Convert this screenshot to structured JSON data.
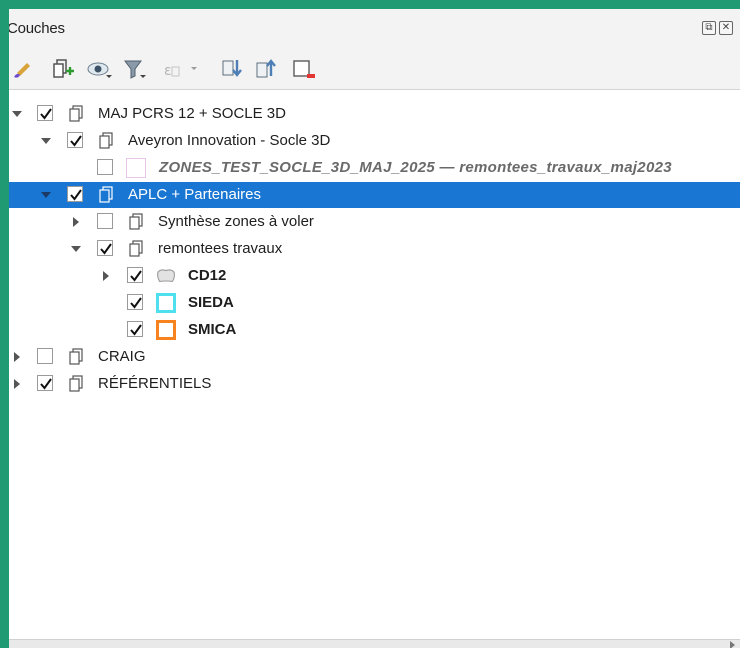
{
  "panel": {
    "title": "Couches"
  },
  "toolbar": {
    "icons": [
      "paint-brush-icon",
      "add-group-icon",
      "visibility-eye-icon",
      "filter-icon",
      "filter-expression-icon",
      "expand-all-icon",
      "collapse-all-icon",
      "remove-layer-icon"
    ]
  },
  "layers": [
    {
      "label": "MAJ PCRS 12 + SOCLE 3D",
      "checked": true,
      "expanded": true,
      "type": "group"
    },
    {
      "label": "Aveyron Innovation - Socle 3D",
      "checked": true,
      "expanded": true,
      "type": "group"
    },
    {
      "label": "ZONES_TEST_SOCLE_3D_MAJ_2025 — remontees_travaux_maj2023",
      "checked": false,
      "type": "layer",
      "style": "italic"
    },
    {
      "label": "APLC + Partenaires",
      "checked": true,
      "expanded": true,
      "type": "group",
      "selected": true
    },
    {
      "label": "Synthèse zones à voler",
      "checked": false,
      "expanded": false,
      "type": "group"
    },
    {
      "label": "remontees travaux",
      "checked": true,
      "expanded": true,
      "type": "group"
    },
    {
      "label": "CD12",
      "checked": true,
      "expanded": false,
      "type": "layer",
      "style": "bold"
    },
    {
      "label": "SIEDA",
      "checked": true,
      "type": "layer",
      "style": "bold",
      "color": "#4ee0ee"
    },
    {
      "label": "SMICA",
      "checked": true,
      "type": "layer",
      "style": "bold",
      "color": "#f7821e"
    },
    {
      "label": "CRAIG",
      "checked": false,
      "expanded": false,
      "type": "group"
    },
    {
      "label": "RÉFÉRENTIELS",
      "checked": true,
      "expanded": false,
      "type": "group"
    }
  ],
  "colors": {
    "selection": "#1976d2",
    "border": "#1f9a72"
  }
}
